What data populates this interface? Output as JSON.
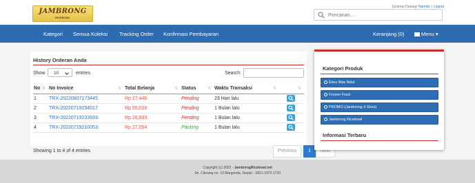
{
  "header": {
    "logo_text": "JAMBRONG",
    "logo_sub": "RICEBOWL",
    "welcome": "Selamat Datang!",
    "user_name": "Namda",
    "separator": "»",
    "logout": "Logout",
    "search_placeholder": "Pencarian..."
  },
  "nav": {
    "items": [
      "Kategori",
      "Semua Koleksi",
      "Tracking Order",
      "Konfirmasi Pembayaran"
    ],
    "cart": "Keranjang (0)",
    "menu": "Menu"
  },
  "orders": {
    "title": "History Orderan Anda",
    "show": "Show",
    "page_size": "10",
    "entries": "entries",
    "search_label": "Search:",
    "columns": [
      "No",
      "No Invoice",
      "Total Belanja",
      "Status",
      "Waktu Transaksi",
      ""
    ],
    "rows": [
      {
        "no": "1",
        "invoice": "TRX-20220807173445",
        "total": "Rp 27.446",
        "status": "Pending",
        "time": "23 Hari lalu"
      },
      {
        "no": "2",
        "invoice": "TRX-20220719234017",
        "total": "Rp 55,018",
        "status": "Pending",
        "time": "1 Bulan lalu"
      },
      {
        "no": "3",
        "invoice": "TRX-20220719233933",
        "total": "Rp 26,933",
        "status": "Pending",
        "time": "1 Bulan lalu"
      },
      {
        "no": "4",
        "invoice": "TRX-20220719210053",
        "total": "Rp 27.054",
        "status": "Packing",
        "time": "1 Bulan lalu"
      }
    ],
    "info": "Showing 1 to 4 of 4 entries",
    "previous": "Previous",
    "current_page": "1",
    "next": "Next"
  },
  "sidebar": {
    "title": "Kategori Produk",
    "categories": [
      "Ekes Mas Ndut",
      "Frozen Food",
      "PROMO (Jambrong X Ekes)",
      "Jambrong Ricebowl"
    ],
    "info_title": "Informasi Terbaru"
  },
  "footer": {
    "copyright": "Copyright (c) 2022 -",
    "brand": "JambrongRicebowl.net",
    "address": "Jln. Cikoang no. 10 Margonda, Depok - 0821-1972-1733"
  },
  "colors": {
    "nav_bg": "#2f6bb0",
    "accent_red": "#c9302c",
    "link_blue": "#2f6db5",
    "category_button": "#2e6db5",
    "view_button": "#3aa4d9"
  }
}
